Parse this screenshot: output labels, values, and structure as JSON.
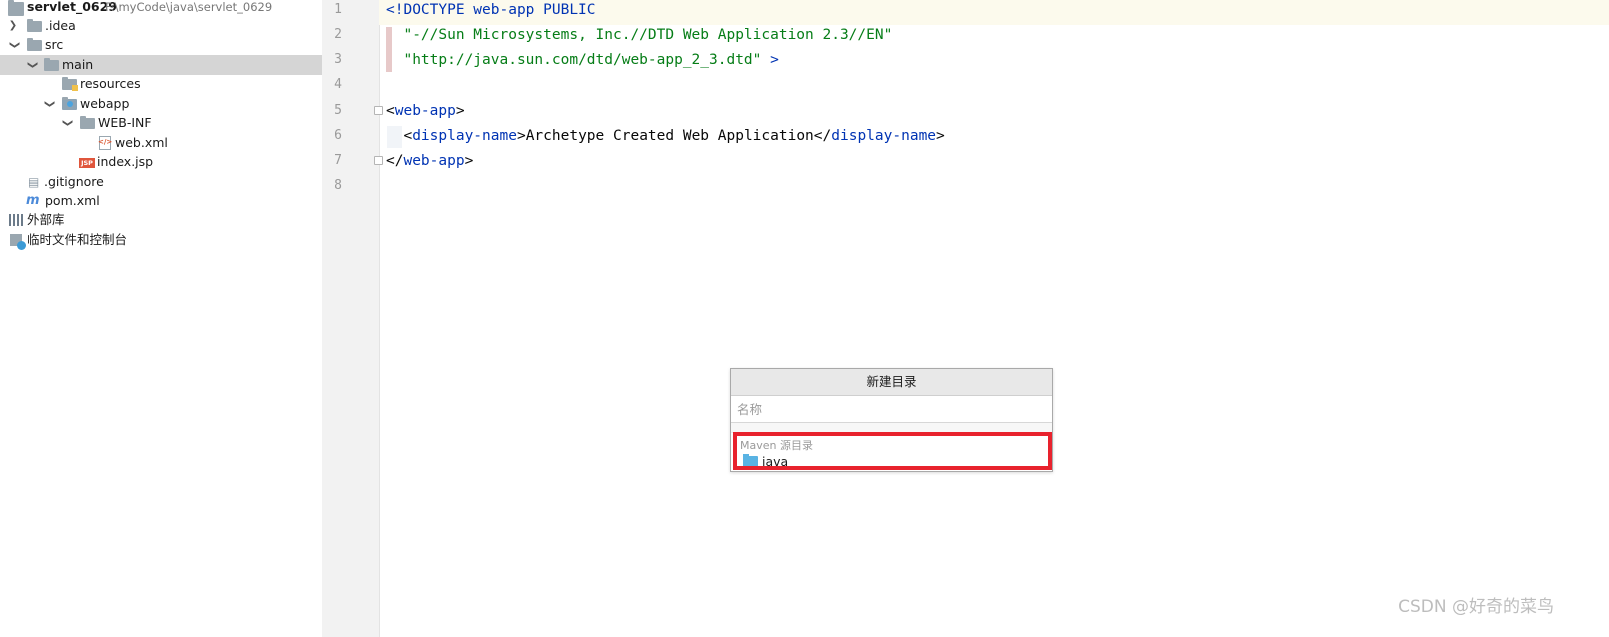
{
  "tree": {
    "project_name": "servlet_0629",
    "project_path": "F:\\myCode\\java\\servlet_0629",
    "items": [
      {
        "label": ".idea"
      },
      {
        "label": "src"
      },
      {
        "label": "main"
      },
      {
        "label": "resources"
      },
      {
        "label": "webapp"
      },
      {
        "label": "WEB-INF"
      },
      {
        "label": "web.xml"
      },
      {
        "label": "index.jsp"
      },
      {
        "label": ".gitignore"
      },
      {
        "label": "pom.xml"
      },
      {
        "label": "外部库"
      },
      {
        "label": "临时文件和控制台"
      }
    ],
    "jsp_badge": "JSP"
  },
  "editor": {
    "line_numbers": [
      "1",
      "2",
      "3",
      "4",
      "5",
      "6",
      "7",
      "8"
    ],
    "code": {
      "l1_a": "<!DOCTYPE web-app PUBLIC",
      "l2_a": "\"-//Sun Microsystems, Inc.//DTD Web Application 2.3//EN\"",
      "l3_a": "\"http://java.sun.com/dtd/web-app_2_3.dtd\"",
      "l3_b": " >",
      "l5_open": "<",
      "l5_tag": "web-app",
      "l5_close": ">",
      "l6_open": "<",
      "l6_tag": "display-name",
      "l6_gt": ">",
      "l6_text": "Archetype Created Web Application",
      "l6_endopen": "</",
      "l6_endtag": "display-name",
      "l6_endgt": ">",
      "l7_open": "</",
      "l7_tag": "web-app",
      "l7_close": ">"
    }
  },
  "popup": {
    "title": "新建目录",
    "placeholder": "名称",
    "group_label": "Maven 源目录",
    "item_label": "java"
  },
  "colors": {
    "highlight_box": "#e8222d",
    "keyword": "#0033b3",
    "string": "#067d17"
  },
  "watermark": "CSDN @好奇的菜鸟"
}
